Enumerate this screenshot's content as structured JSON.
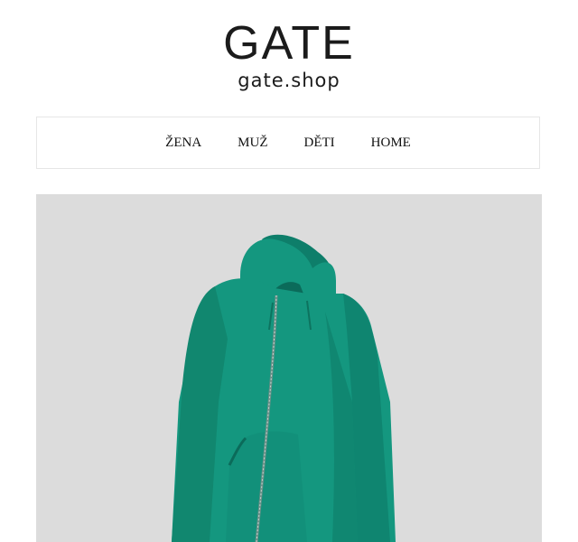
{
  "brand": {
    "logo_text": "GATE",
    "domain": "gate.shop"
  },
  "nav": {
    "items": [
      {
        "label": "ŽENA"
      },
      {
        "label": "MUŽ"
      },
      {
        "label": "DĚTI"
      },
      {
        "label": "HOME"
      }
    ]
  },
  "hero": {
    "background": "#dcdcdc",
    "product_color": "#12907a"
  }
}
